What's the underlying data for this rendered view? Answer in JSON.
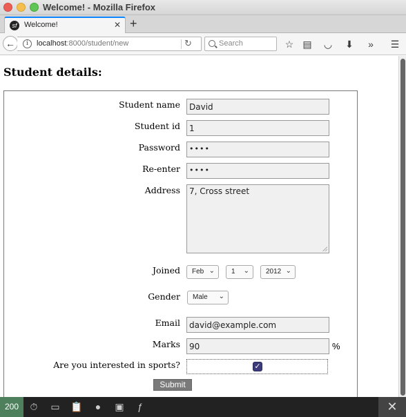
{
  "window": {
    "title": "Welcome! - Mozilla Firefox"
  },
  "tab": {
    "title": "Welcome!",
    "favicon": "sf",
    "new_tab": "+"
  },
  "nav": {
    "url_host": "localhost",
    "url_path": ":8000/student/new",
    "search_placeholder": "Search"
  },
  "page": {
    "heading": "Student details:",
    "fields": {
      "name": {
        "label": "Student name",
        "value": "David"
      },
      "id": {
        "label": "Student id",
        "value": "1"
      },
      "password": {
        "label": "Password",
        "value": "••••"
      },
      "reenter": {
        "label": "Re-enter",
        "value": "••••"
      },
      "address": {
        "label": "Address",
        "value": "7, Cross street"
      },
      "joined": {
        "label": "Joined",
        "month": "Feb",
        "day": "1",
        "year": "2012"
      },
      "gender": {
        "label": "Gender",
        "value": "Male"
      },
      "email": {
        "label": "Email",
        "value": "david@example.com"
      },
      "marks": {
        "label": "Marks",
        "value": "90",
        "unit": "%"
      },
      "sports": {
        "label": "Are you interested in sports?",
        "checked": true
      }
    },
    "submit_label": "Submit"
  },
  "debug": {
    "status": "200"
  }
}
